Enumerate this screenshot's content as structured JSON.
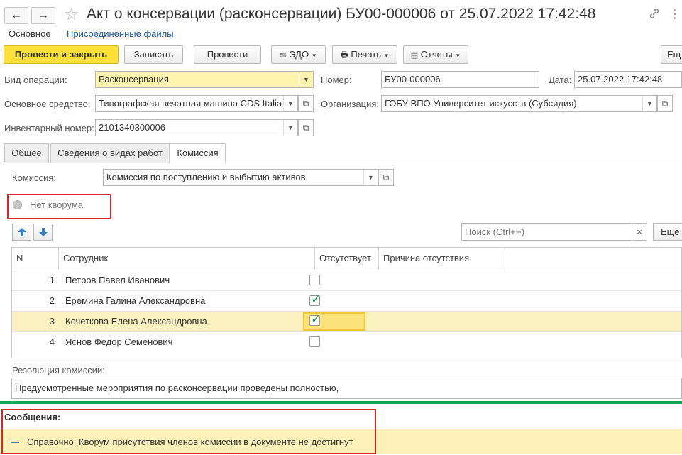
{
  "window": {
    "title": "Акт о консервации (расконсервации) БУ00-000006 от 25.07.2022 17:42:48",
    "nav_back": "←",
    "nav_forward": "→",
    "star": "☆",
    "link_icon": "🔗",
    "more_icon": "⋮"
  },
  "page_tabs": {
    "main": "Основное",
    "files": "Присоединенные файлы"
  },
  "toolbar": {
    "post_close": "Провести и закрыть",
    "save": "Записать",
    "post": "Провести",
    "edo": "ЭДО",
    "print": "Печать",
    "reports": "Отчеты",
    "more": "Ещ"
  },
  "form": {
    "operation_label": "Вид операции:",
    "operation_value": "Расконсервация",
    "number_label": "Номер:",
    "number_value": "БУ00-000006",
    "date_label": "Дата:",
    "date_value": "25.07.2022 17:42:48",
    "asset_label": "Основное средство:",
    "asset_value": "Типографская печатная машина CDS Italia",
    "org_label": "Организация:",
    "org_value": "ГОБУ ВПО Университет искусств (Субсидия)",
    "inv_label": "Инвентарный номер:",
    "inv_value": "2101340300006"
  },
  "tabs": [
    "Общее",
    "Сведения о видах работ",
    "Комиссия"
  ],
  "commission": {
    "label": "Комиссия:",
    "value": "Комиссия по поступлению и выбытию активов",
    "quorum": "Нет кворума",
    "search_placeholder": "Поиск (Ctrl+F)",
    "search_clear": "×",
    "more": "Еще"
  },
  "table": {
    "headers": [
      "N",
      "Сотрудник",
      "Отсутствует",
      "Причина отсутствия"
    ],
    "rows": [
      {
        "n": "1",
        "name": "Петров Павел Иванович",
        "absent": false,
        "reason": ""
      },
      {
        "n": "2",
        "name": "Еремина Галина Александровна",
        "absent": true,
        "reason": ""
      },
      {
        "n": "3",
        "name": "Кочеткова Елена Александровна",
        "absent": true,
        "reason": ""
      },
      {
        "n": "4",
        "name": "Яснов Федор Семенович",
        "absent": false,
        "reason": ""
      }
    ]
  },
  "resolution": {
    "label": "Резолюция комиссии:",
    "value": "Предусмотренные мероприятия по расконсервации проведены полностью,"
  },
  "messages": {
    "title": "Сообщения:",
    "items": [
      "Справочно: Кворум присутствия членов комиссии в документе не достигнут"
    ]
  },
  "colors": {
    "primary_button": "#ffdf39",
    "highlight_frame": "#d9262a",
    "separator": "#1fa550",
    "message_bg": "#fdf0b8",
    "selected_row": "#fbf1c0",
    "check": "#1d9a3c",
    "link": "#1a5aa8"
  }
}
